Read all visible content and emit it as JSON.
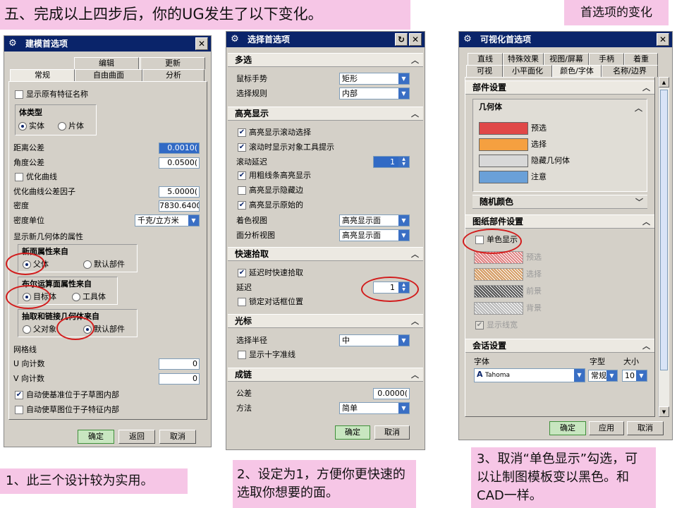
{
  "annotations": {
    "top_banner": "五、完成以上四步后，你的UG发生了以下变化。",
    "top_right": "首选项的变化",
    "note1": "1、此三个设计较为实用。",
    "note2": "2、设定为1，方便你更快速的选取你想要的面。",
    "note3": "3、取消“单色显示”勾选，可以让制图模板变以黑色。和CAD一样。"
  },
  "modeling": {
    "title": "建模首选项",
    "close": "✕",
    "tabs_row1": [
      "编辑",
      "仿真",
      "更新"
    ],
    "tabs_row2": [
      "常规",
      "自由曲面",
      "分析"
    ],
    "show_feature_names": "显示原有特征名称",
    "body_type": {
      "label": "体类型",
      "solid": "实体",
      "sheet": "片体"
    },
    "distance_tol": {
      "label": "距离公差",
      "value": "0.0010("
    },
    "angle_tol": {
      "label": "角度公差",
      "value": "0.0500("
    },
    "optimize_curves": "优化曲线",
    "optimize_factor": {
      "label": "优化曲线公差因子",
      "value": "5.0000("
    },
    "density": {
      "label": "密度",
      "value": "7830.6400"
    },
    "density_unit": {
      "label": "密度单位",
      "value": "千克/立方米"
    },
    "new_face_props": "显示新几何体的属性",
    "new_face_from": {
      "label": "新面属性来自",
      "parent": "父体",
      "default": "默认部件"
    },
    "boolean_from": {
      "label": "布尔运算面属性来自",
      "target": "目标体",
      "tool": "工具体"
    },
    "extract_from": {
      "label": "抽取和链接几何体来自",
      "parent": "父对象",
      "default": "默认部件"
    },
    "grid": {
      "label": "网格线",
      "u_label": "U 向计数",
      "u_value": "0",
      "v_label": "V 向计数",
      "v_value": "0"
    },
    "auto_datum": "自动使基准位于子草图内部",
    "auto_sketch": "自动使草图位于子特征内部",
    "ok": "确定",
    "back": "返回",
    "cancel": "取消"
  },
  "selection": {
    "title": "选择首选项",
    "reset": "↻",
    "close": "✕",
    "multi": {
      "header": "多选",
      "gesture_label": "鼠标手势",
      "gesture_value": "矩形",
      "rule_label": "选择规则",
      "rule_value": "内部"
    },
    "highlight": {
      "header": "高亮显示",
      "rollover": "高亮显示滚动选择",
      "tooltip": "滚动时显示对象工具提示",
      "delay_label": "滚动延迟",
      "delay_value": "1",
      "thick": "用粗线条高亮显示",
      "hidden": "高亮显示隐藏边",
      "original": "高亮显示原始的",
      "shaded_label": "着色视图",
      "shaded_value": "高亮显示面",
      "analysis_label": "面分析视图",
      "analysis_value": "高亮显示面"
    },
    "quickpick": {
      "header": "快速拾取",
      "delayed": "延迟时快速拾取",
      "delay_label": "延迟",
      "delay_value": "1",
      "lock": "锁定对话框位置"
    },
    "cursor": {
      "header": "光标",
      "radius_label": "选择半径",
      "radius_value": "中",
      "crosshair": "显示十字准线"
    },
    "chain": {
      "header": "成链",
      "tol_label": "公差",
      "tol_value": "0.0000(",
      "method_label": "方法",
      "method_value": "简单"
    },
    "ok": "确定",
    "cancel": "取消"
  },
  "visualization": {
    "title": "可视化首选项",
    "close": "✕",
    "tabs_row1": [
      "直线",
      "特殊效果",
      "视图/屏幕",
      "手柄",
      "着重"
    ],
    "tabs_row2": [
      "可视",
      "小平面化",
      "颜色/字体",
      "名称/边界"
    ],
    "part_settings": "部件设置",
    "geometry": "几何体",
    "colors": [
      {
        "label": "预选",
        "color": "#e04848"
      },
      {
        "label": "选择",
        "color": "#f5a040"
      },
      {
        "label": "隐藏几何体",
        "color": "#d8d8d8"
      },
      {
        "label": "注意",
        "color": "#6aa0d8"
      }
    ],
    "random_colors": "随机颜色",
    "drawing_settings": "图纸部件设置",
    "monochrome": "单色显示",
    "mono_colors": [
      {
        "label": "预选",
        "color": "#e08080"
      },
      {
        "label": "选择",
        "color": "#d49a60"
      },
      {
        "label": "前景",
        "color": "#505050"
      },
      {
        "label": "背景",
        "color": "#b8b8b8"
      }
    ],
    "show_width": "显示线宽",
    "session": "会话设置",
    "font_label": "字体",
    "font_value": "Tahoma",
    "font_style_label": "字型",
    "font_style_value": "常规",
    "font_size_label": "大小",
    "font_size_value": "10",
    "ok": "确定",
    "apply": "应用",
    "cancel": "取消"
  }
}
